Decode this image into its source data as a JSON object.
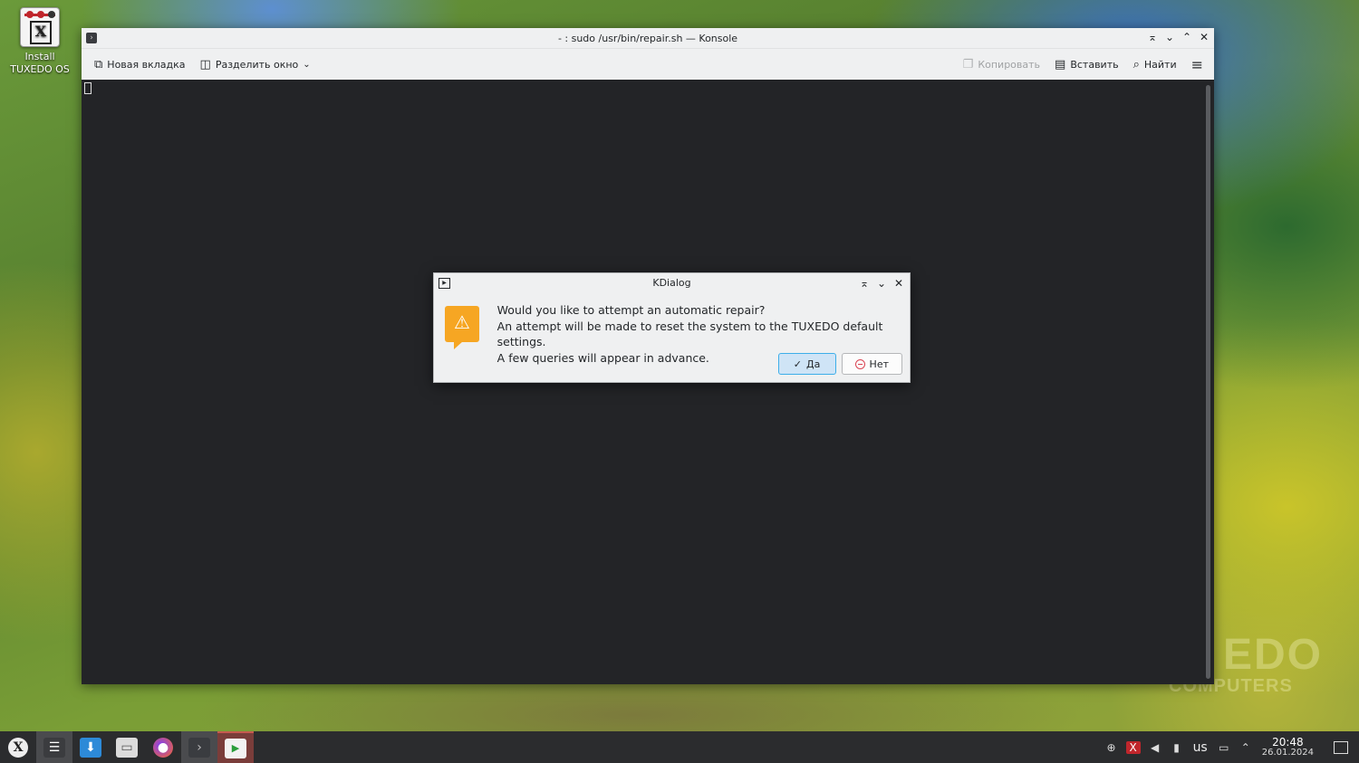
{
  "desktop": {
    "icon_label": "Install TUXEDO OS",
    "watermark_top": "EDO",
    "watermark_bottom": "COMPUTERS"
  },
  "konsole": {
    "title": "- : sudo /usr/bin/repair.sh — Konsole",
    "toolbar": {
      "new_tab": "Новая вкладка",
      "split_view": "Разделить окно",
      "copy": "Копировать",
      "paste": "Вставить",
      "find": "Найти"
    }
  },
  "kdialog": {
    "title": "KDialog",
    "line1": "Would you like to attempt an automatic repair?",
    "line2": "An attempt will be made to reset the system to the TUXEDO default settings.",
    "line3": "A few queries will appear in advance.",
    "yes_label": "Да",
    "no_label": "Нет"
  },
  "taskbar": {
    "keyboard_layout": "us",
    "time": "20:48",
    "date": "26.01.2024"
  },
  "colors": {
    "accent": "#3daee9",
    "warning": "#f6a623",
    "terminal_bg": "#232427",
    "panel_bg": "#2b2c2e"
  },
  "icons": [
    "tuxedo-launcher-icon",
    "settings-icon",
    "store-icon",
    "files-icon",
    "firefox-icon",
    "konsole-icon",
    "media-icon"
  ]
}
